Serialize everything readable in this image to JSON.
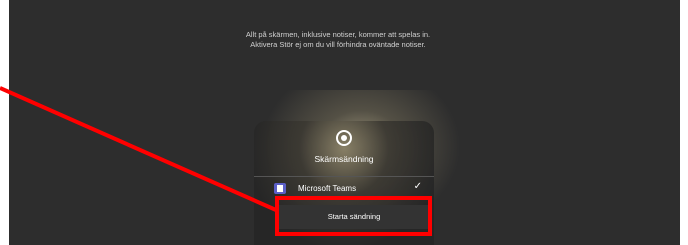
{
  "notice": {
    "text": "Allt på skärmen, inklusive notiser, kommer att spelas in. Aktivera Stör ej om du vill förhindra oväntade notiser."
  },
  "broadcast_panel": {
    "title": "Skärmsändning",
    "icon": "record-icon",
    "app": {
      "name": "Microsoft Teams",
      "icon": "teams-icon",
      "selected": true,
      "check": "✓"
    },
    "start_label": "Starta sändning"
  },
  "annotation": {
    "color": "#ff0000"
  }
}
